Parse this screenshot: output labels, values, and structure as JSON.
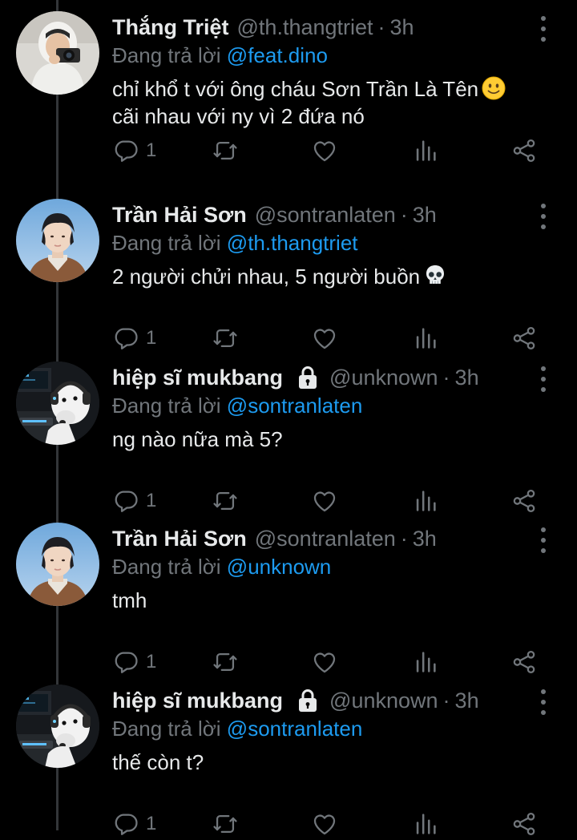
{
  "labels": {
    "replying_to": "Đang trả lời",
    "separator": "·"
  },
  "colors": {
    "background": "#000000",
    "text": "#e7e9ea",
    "muted": "#71767b",
    "accent": "#1d9bf0"
  },
  "tweets": [
    {
      "name": "Thắng Triệt",
      "handle": "@th.thangtriet",
      "time": "3h",
      "reply_to": "@feat.dino",
      "text1": "chỉ khổ t với ông cháu Sơn Trần Là Tên",
      "text2": "cãi nhau với ny vì 2 đứa nó",
      "emoji": "slightly-smiling-face",
      "reply_count": "1",
      "locked": false,
      "avatar": "photo-person-camera"
    },
    {
      "name": "Trần Hải Sơn",
      "handle": "@sontranlaten",
      "time": "3h",
      "reply_to": "@th.thangtriet",
      "text1": "2 người chửi nhau, 5 người buồn",
      "text2": "",
      "emoji": "skull",
      "reply_count": "1",
      "locked": false,
      "avatar": "photo-young-man"
    },
    {
      "name": "hiệp sĩ mukbang",
      "handle": "@unknown",
      "time": "3h",
      "reply_to": "@sontranlaten",
      "text1": "ng nào nữa mà 5?",
      "text2": "",
      "emoji": "",
      "reply_count": "1",
      "locked": true,
      "avatar": "photo-dog-headphones"
    },
    {
      "name": "Trần Hải Sơn",
      "handle": "@sontranlaten",
      "time": "3h",
      "reply_to": "@unknown",
      "text1": "tmh",
      "text2": "",
      "emoji": "",
      "reply_count": "1",
      "locked": false,
      "avatar": "photo-young-man"
    },
    {
      "name": "hiệp sĩ mukbang",
      "handle": "@unknown",
      "time": "3h",
      "reply_to": "@sontranlaten",
      "text1": "thế còn t?",
      "text2": "",
      "emoji": "",
      "reply_count": "1",
      "locked": true,
      "avatar": "photo-dog-headphones"
    }
  ],
  "action_icons": [
    "reply-icon",
    "retweet-icon",
    "like-icon",
    "analytics-icon",
    "share-icon"
  ]
}
